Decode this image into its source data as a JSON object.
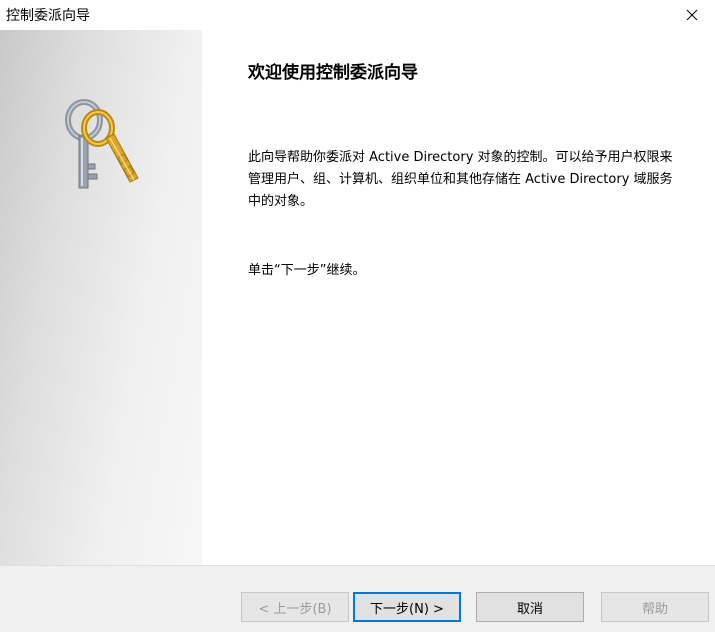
{
  "window": {
    "title": "控制委派向导",
    "close_icon": "close-icon"
  },
  "left_panel": {
    "icon": "keys-icon",
    "colors": {
      "key_gold": "#d9a72b",
      "key_silver": "#9aa3ad"
    }
  },
  "main": {
    "heading": "欢迎使用控制委派向导",
    "description": "此向导帮助你委派对 Active Directory 对象的控制。可以给予用户权限来管理用户、组、计算机、组织单位和其他存储在 Active Directory 域服务中的对象。",
    "continue_hint": "单击“下一步”继续。"
  },
  "buttons": {
    "back": "< 上一步(B)",
    "next": "下一步(N) >",
    "cancel": "取消",
    "help": "帮助"
  },
  "colors": {
    "focus_border": "#0078d7",
    "footer_bg": "#f0f0f0"
  }
}
